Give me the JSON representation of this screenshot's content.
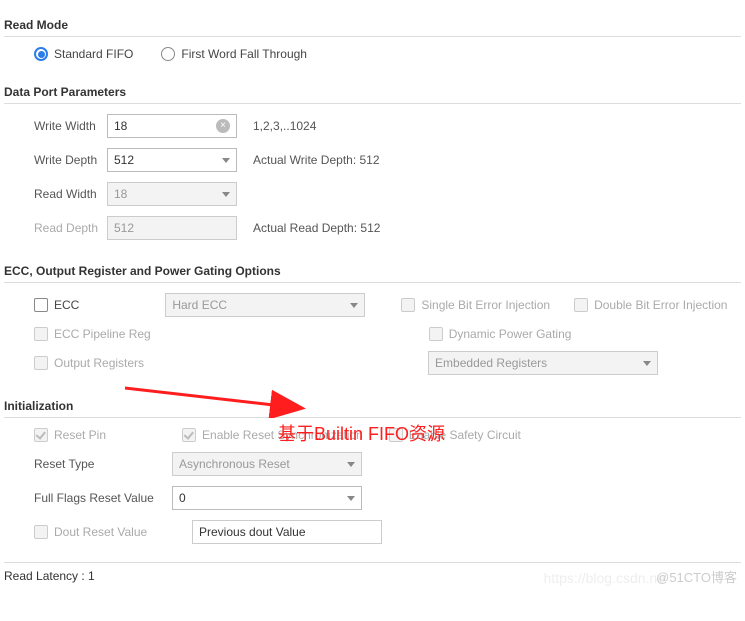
{
  "sections": {
    "read_mode": {
      "title": "Read Mode",
      "options": {
        "standard": "Standard FIFO",
        "fwft": "First Word Fall Through"
      },
      "selected": "standard"
    },
    "data_port": {
      "title": "Data Port Parameters",
      "write_width": {
        "label": "Write Width",
        "value": "18",
        "hint": "1,2,3,..1024"
      },
      "write_depth": {
        "label": "Write Depth",
        "value": "512",
        "actual": "Actual Write Depth: 512"
      },
      "read_width": {
        "label": "Read Width",
        "value": "18"
      },
      "read_depth": {
        "label": "Read Depth",
        "value": "512",
        "actual": "Actual Read Depth: 512"
      }
    },
    "ecc": {
      "title": "ECC, Output Register and Power Gating Options",
      "ecc_label": "ECC",
      "ecc_type": "Hard ECC",
      "single_bit": "Single Bit Error Injection",
      "double_bit": "Double Bit Error Injection",
      "pipeline": "ECC Pipeline Reg",
      "dpg": "Dynamic Power Gating",
      "out_reg": "Output Registers",
      "embedded": "Embedded Registers"
    },
    "init": {
      "title": "Initialization",
      "reset_pin": "Reset Pin",
      "enable_sync": "Enable Reset Synchronization",
      "safety": "Enable Safety Circuit",
      "reset_type": {
        "label": "Reset Type",
        "value": "Asynchronous Reset"
      },
      "full_flags": {
        "label": "Full Flags Reset Value",
        "value": "0"
      },
      "dout_reset": {
        "label": "Dout Reset Value",
        "value": "Previous dout Value"
      }
    }
  },
  "footer": {
    "read_latency": "Read Latency : 1"
  },
  "annotation": "基于Builtin FIFO资源",
  "watermark1": "https://blog.csdn.ne",
  "watermark2": "@51CTO博客"
}
